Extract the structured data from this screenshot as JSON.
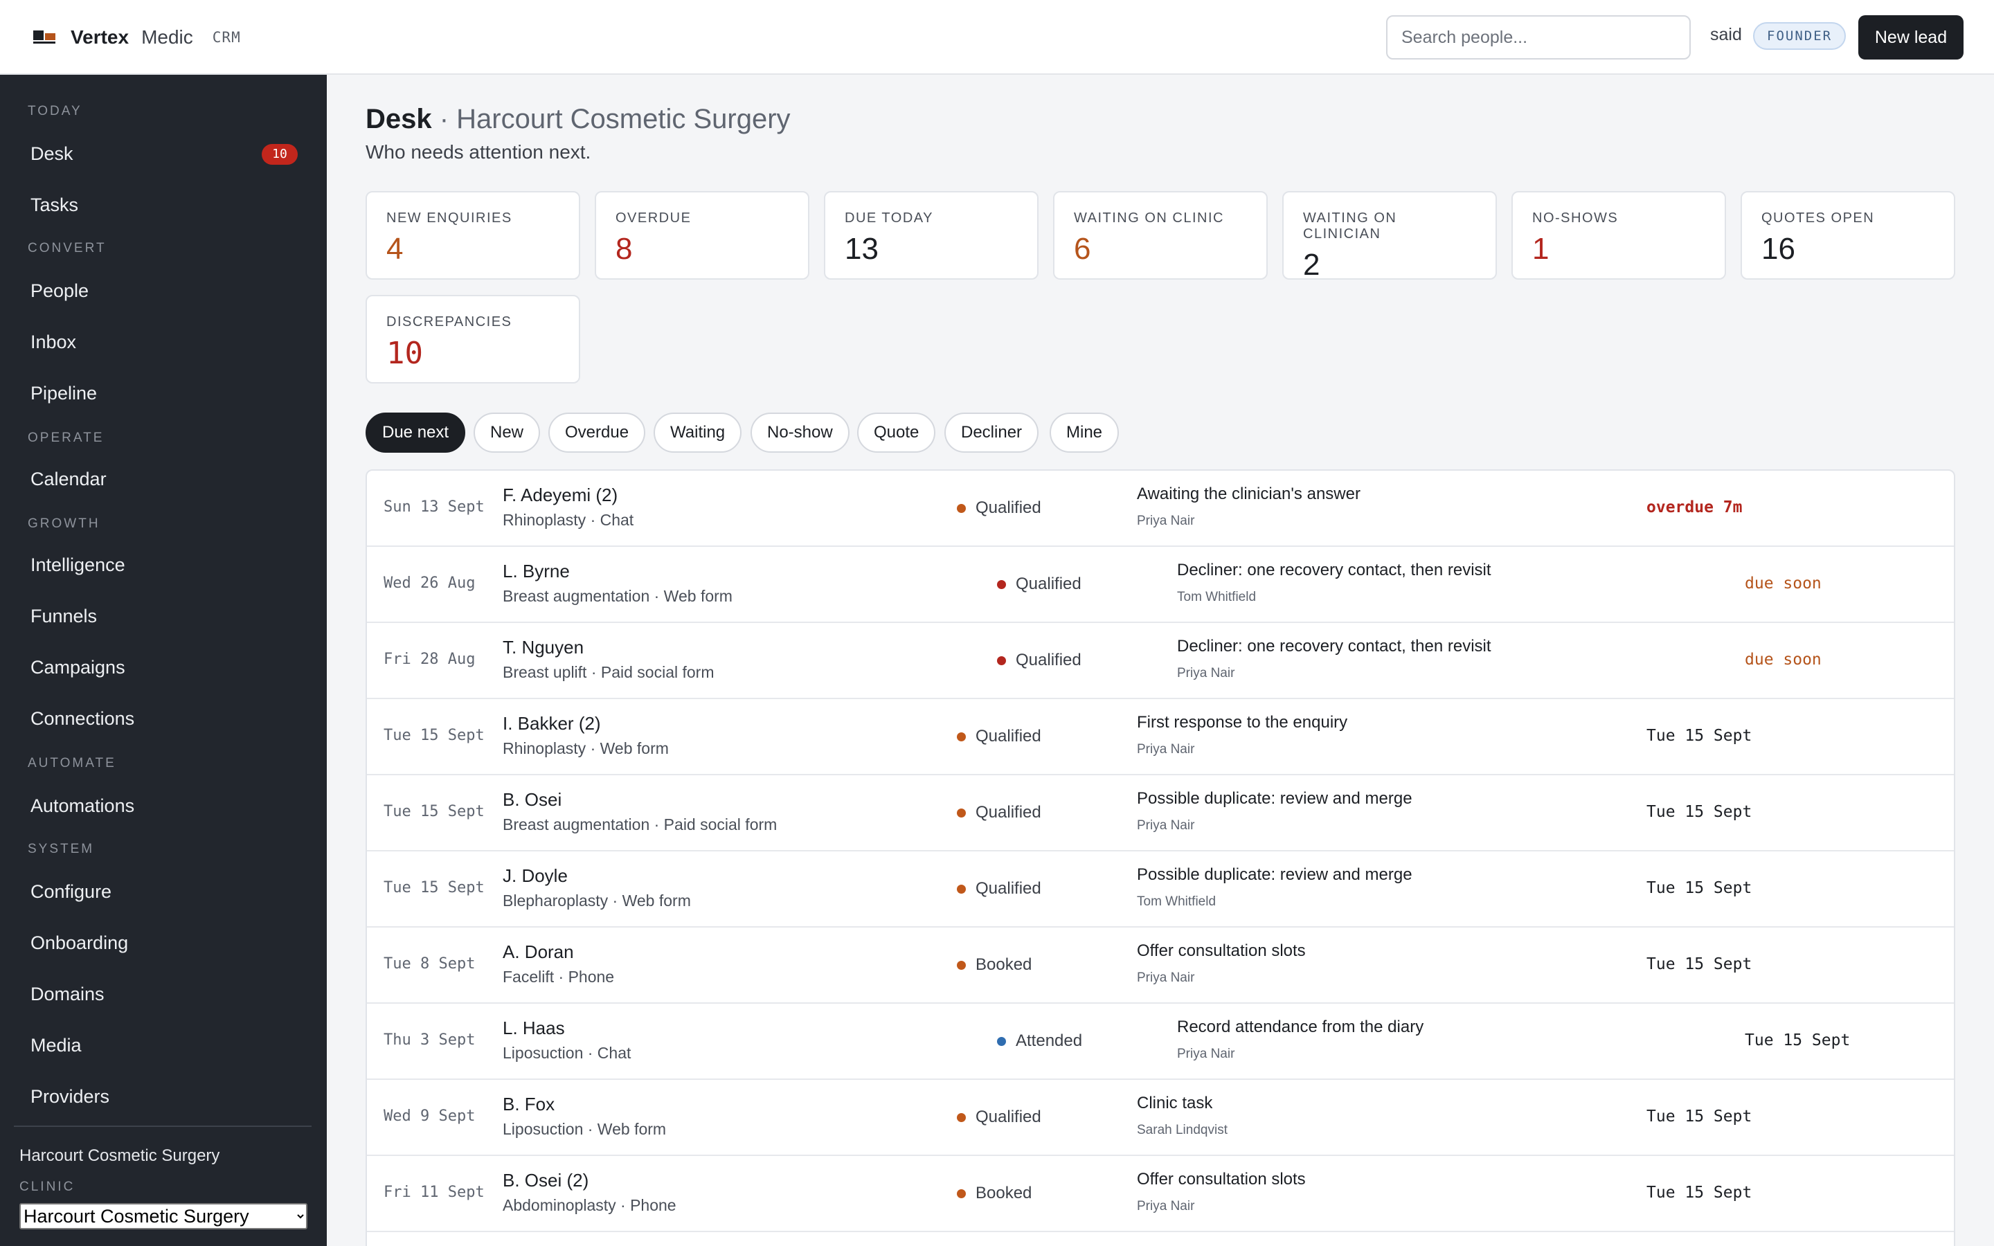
{
  "header": {
    "brand": "Vertex",
    "brand_sub": "Medic",
    "product": "CRM",
    "search_placeholder": "Search people...",
    "user": "said",
    "role": "FOUNDER",
    "new_lead_label": "New lead"
  },
  "sidebar": {
    "groups": [
      {
        "label": "TODAY",
        "items": [
          {
            "label": "Desk",
            "count": "10"
          },
          {
            "label": "Tasks"
          }
        ]
      },
      {
        "label": "CONVERT",
        "items": [
          {
            "label": "People"
          },
          {
            "label": "Inbox"
          },
          {
            "label": "Pipeline"
          }
        ]
      },
      {
        "label": "OPERATE",
        "items": [
          {
            "label": "Calendar"
          }
        ]
      },
      {
        "label": "GROWTH",
        "items": [
          {
            "label": "Intelligence"
          },
          {
            "label": "Funnels"
          },
          {
            "label": "Campaigns"
          },
          {
            "label": "Connections"
          }
        ]
      },
      {
        "label": "AUTOMATE",
        "items": [
          {
            "label": "Automations"
          }
        ]
      },
      {
        "label": "SYSTEM",
        "items": [
          {
            "label": "Configure"
          },
          {
            "label": "Onboarding"
          },
          {
            "label": "Domains"
          },
          {
            "label": "Media"
          },
          {
            "label": "Providers"
          }
        ]
      }
    ],
    "clinic_name": "Harcourt Cosmetic Surgery",
    "clinic_label": "CLINIC",
    "clinic_selected": "Harcourt Cosmetic Surgery"
  },
  "page": {
    "title": "Desk",
    "title_separator": " · ",
    "clinic": "Harcourt Cosmetic Surgery",
    "subtitle": "Who needs attention next."
  },
  "stats": [
    {
      "label": "NEW ENQUIRIES",
      "value": "4",
      "tone": "orange"
    },
    {
      "label": "OVERDUE",
      "value": "8",
      "tone": "red"
    },
    {
      "label": "DUE TODAY",
      "value": "13",
      "tone": "dark"
    },
    {
      "label": "WAITING ON CLINIC",
      "value": "6",
      "tone": "orange"
    },
    {
      "label": "WAITING ON CLINICIAN",
      "value": "2",
      "tone": "dark"
    },
    {
      "label": "NO-SHOWS",
      "value": "1",
      "tone": "red"
    },
    {
      "label": "QUOTES OPEN",
      "value": "16",
      "tone": "dark"
    },
    {
      "label": "DISCREPANCIES",
      "value": "10",
      "tone": "red"
    }
  ],
  "filters": [
    {
      "label": "Due next",
      "active": true
    },
    {
      "label": "New"
    },
    {
      "label": "Overdue"
    },
    {
      "label": "Waiting"
    },
    {
      "label": "No-show"
    },
    {
      "label": "Quote"
    },
    {
      "label": "Decliner"
    },
    {
      "label": "Mine"
    }
  ],
  "rows": [
    {
      "date": "Sun 13 Sept",
      "name": "F. Adeyemi (2)",
      "meta": "Rhinoplasty · Chat",
      "stage": "Qualified",
      "dot": "#c0581a",
      "task": "Awaiting the clinician's answer",
      "owner": "Priya Nair",
      "due": "overdue 7m",
      "due_tone": "overdue",
      "indent": false
    },
    {
      "date": "Wed 26 Aug",
      "name": "L. Byrne",
      "meta": "Breast augmentation · Web form",
      "stage": "Qualified",
      "dot": "#b3261e",
      "task": "Decliner: one recovery contact, then revisit",
      "owner": "Tom Whitfield",
      "due": "due soon",
      "due_tone": "soon",
      "indent": true
    },
    {
      "date": "Fri 28 Aug",
      "name": "T. Nguyen",
      "meta": "Breast uplift · Paid social form",
      "stage": "Qualified",
      "dot": "#b3261e",
      "task": "Decliner: one recovery contact, then revisit",
      "owner": "Priya Nair",
      "due": "due soon",
      "due_tone": "soon",
      "indent": true
    },
    {
      "date": "Tue 15 Sept",
      "name": "I. Bakker (2)",
      "meta": "Rhinoplasty · Web form",
      "stage": "Qualified",
      "dot": "#c0581a",
      "task": "First response to the enquiry",
      "owner": "Priya Nair",
      "due": "Tue 15 Sept",
      "due_tone": "normal",
      "indent": false
    },
    {
      "date": "Tue 15 Sept",
      "name": "B. Osei",
      "meta": "Breast augmentation · Paid social form",
      "stage": "Qualified",
      "dot": "#c0581a",
      "task": "Possible duplicate: review and merge",
      "owner": "Priya Nair",
      "due": "Tue 15 Sept",
      "due_tone": "normal",
      "indent": false
    },
    {
      "date": "Tue 15 Sept",
      "name": "J. Doyle",
      "meta": "Blepharoplasty · Web form",
      "stage": "Qualified",
      "dot": "#c0581a",
      "task": "Possible duplicate: review and merge",
      "owner": "Tom Whitfield",
      "due": "Tue 15 Sept",
      "due_tone": "normal",
      "indent": false
    },
    {
      "date": "Tue 8 Sept",
      "name": "A. Doran",
      "meta": "Facelift · Phone",
      "stage": "Booked",
      "dot": "#c0581a",
      "task": "Offer consultation slots",
      "owner": "Priya Nair",
      "due": "Tue 15 Sept",
      "due_tone": "normal",
      "indent": false
    },
    {
      "date": "Thu 3 Sept",
      "name": "L. Haas",
      "meta": "Liposuction · Chat",
      "stage": "Attended",
      "dot": "#2f6db0",
      "task": "Record attendance from the diary",
      "owner": "Priya Nair",
      "due": "Tue 15 Sept",
      "due_tone": "normal",
      "indent": true
    },
    {
      "date": "Wed 9 Sept",
      "name": "B. Fox",
      "meta": "Liposuction · Web form",
      "stage": "Qualified",
      "dot": "#c0581a",
      "task": "Clinic task",
      "owner": "Sarah Lindqvist",
      "due": "Tue 15 Sept",
      "due_tone": "normal",
      "indent": false
    },
    {
      "date": "Fri 11 Sept",
      "name": "B. Osei (2)",
      "meta": "Abdominoplasty · Phone",
      "stage": "Booked",
      "dot": "#c0581a",
      "task": "Offer consultation slots",
      "owner": "Priya Nair",
      "due": "Tue 15 Sept",
      "due_tone": "normal",
      "indent": false
    }
  ]
}
